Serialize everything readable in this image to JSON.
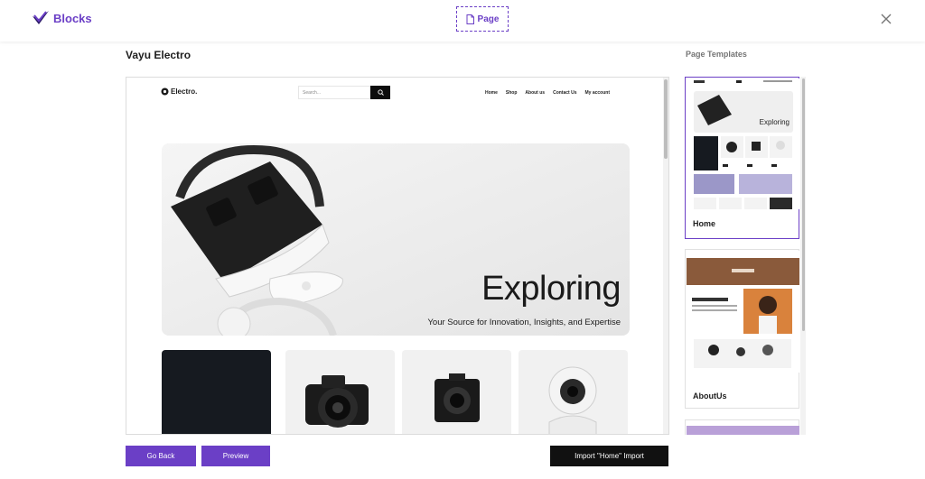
{
  "topbar": {
    "logo_text": "Blocks",
    "page_tab_label": "Page"
  },
  "site_title": "Vayu Electro",
  "templates_title": "Page Templates",
  "preview": {
    "logo_text": "Electro.",
    "search_placeholder": "Search...",
    "nav": [
      "Home",
      "Shop",
      "About us",
      "Contact Us",
      "My account"
    ],
    "hero_title": "Exploring",
    "hero_subtitle": "Your Source for Innovation, Insights, and Expertise"
  },
  "templates": [
    {
      "label": "Home",
      "thumb_title": "Exploring",
      "selected": true
    },
    {
      "label": "AboutUs",
      "selected": false
    }
  ],
  "buttons": {
    "go_back": "Go Back",
    "preview": "Preview",
    "import": "Import \"Home\" Import"
  },
  "colors": {
    "accent": "#6b3fc6",
    "dark": "#111111"
  }
}
